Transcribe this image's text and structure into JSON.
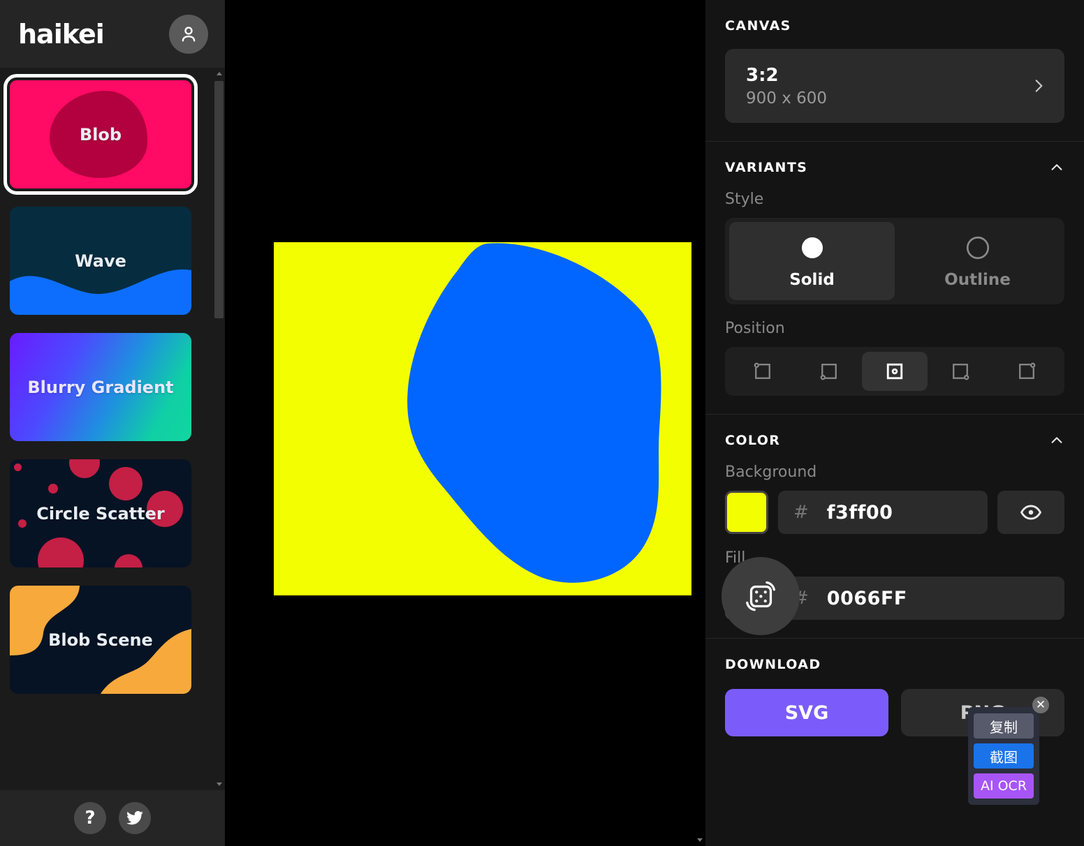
{
  "app": {
    "logo": "haikei",
    "avatar_icon": "user-avatar-icon"
  },
  "sidebar": {
    "items": [
      {
        "label": "Blob",
        "selected": true,
        "icon": "blob-thumbnail"
      },
      {
        "label": "Wave",
        "selected": false,
        "icon": "wave-thumbnail"
      },
      {
        "label": "Blurry Gradient",
        "selected": false,
        "icon": "blurry-gradient-thumbnail"
      },
      {
        "label": "Circle Scatter",
        "selected": false,
        "icon": "circle-scatter-thumbnail"
      },
      {
        "label": "Blob Scene",
        "selected": false,
        "icon": "blob-scene-thumbnail"
      }
    ],
    "footer": {
      "help_label": "?",
      "twitter_icon": "twitter-icon"
    }
  },
  "canvas_preview": {
    "background_color": "#f3ff00",
    "fill_color": "#0066FF",
    "randomize_icon": "dice-icon"
  },
  "panel": {
    "canvas": {
      "title": "CANVAS",
      "ratio": "3:2",
      "dimensions": "900 x 600",
      "chevron_icon": "chevron-right-icon"
    },
    "variants": {
      "title": "VARIANTS",
      "collapse_icon": "chevron-up-icon",
      "style_label": "Style",
      "styles": [
        {
          "label": "Solid",
          "selected": true,
          "icon": "filled-circle-icon"
        },
        {
          "label": "Outline",
          "selected": false,
          "icon": "outline-circle-icon"
        }
      ],
      "position_label": "Position",
      "positions": [
        {
          "name": "position-top-left",
          "selected": false
        },
        {
          "name": "position-bottom-left",
          "selected": false
        },
        {
          "name": "position-center",
          "selected": true
        },
        {
          "name": "position-bottom-right",
          "selected": false
        },
        {
          "name": "position-top-right",
          "selected": false
        }
      ]
    },
    "color": {
      "title": "COLOR",
      "collapse_icon": "chevron-up-icon",
      "background_label": "Background",
      "background_hash": "#",
      "background_hex": "f3ff00",
      "background_swatch": "#f3ff00",
      "visibility_icon": "eye-icon",
      "fill_label": "Fill",
      "fill_hash": "#",
      "fill_hex": "0066FF",
      "fill_swatch": "#0066FF"
    },
    "download": {
      "title": "DOWNLOAD",
      "svg_label": "SVG",
      "png_label": "PNG",
      "svg_color": "#7B5CFA"
    }
  },
  "ocr_popup": {
    "copy_label": "复制",
    "screenshot_label": "截图",
    "ocr_label": "AI OCR",
    "close_label": "✕"
  }
}
